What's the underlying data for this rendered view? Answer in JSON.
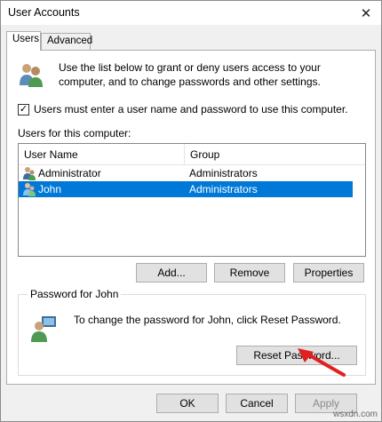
{
  "window": {
    "title": "User Accounts"
  },
  "tabs": [
    {
      "label": "Users"
    },
    {
      "label": "Advanced"
    }
  ],
  "intro": {
    "text": "Use the list below to grant or deny users access to your computer, and to change passwords and other settings."
  },
  "require_login": {
    "label": "Users must enter a user name and password to use this computer.",
    "checked": true
  },
  "users_list": {
    "label": "Users for this computer:",
    "columns": [
      "User Name",
      "Group"
    ],
    "rows": [
      {
        "name": "Administrator",
        "group": "Administrators",
        "selected": false
      },
      {
        "name": "John",
        "group": "Administrators",
        "selected": true
      }
    ]
  },
  "list_buttons": {
    "add": "Add...",
    "remove": "Remove",
    "properties": "Properties"
  },
  "password_group": {
    "title": "Password for John",
    "text": "To change the password for John, click Reset Password.",
    "reset_button": "Reset Password..."
  },
  "footer": {
    "ok": "OK",
    "cancel": "Cancel",
    "apply": "Apply"
  },
  "watermark": "wsxdn.com",
  "colors": {
    "selection": "#0078d7",
    "arrow": "#e02020"
  }
}
